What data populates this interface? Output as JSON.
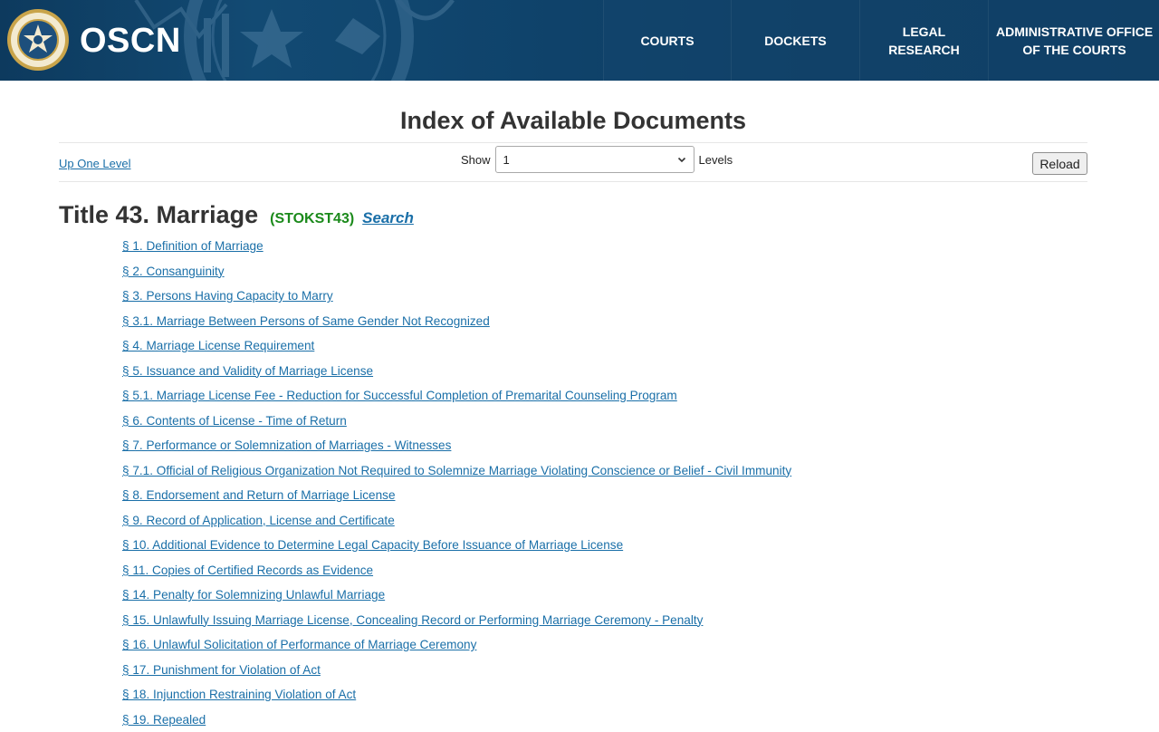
{
  "header": {
    "brand": "OSCN",
    "nav": [
      {
        "label": "COURTS"
      },
      {
        "label": "DOCKETS"
      },
      {
        "label": "LEGAL\nRESEARCH"
      },
      {
        "label": "ADMINISTRATIVE OFFICE\nOF THE COURTS"
      }
    ]
  },
  "page": {
    "title": "Index of Available Documents"
  },
  "controls": {
    "up_link": "Up One Level",
    "show_label": "Show",
    "levels_value": "1",
    "levels_label": "Levels",
    "reload_label": "Reload"
  },
  "title_block": {
    "title": "Title 43. Marriage",
    "code": "(STOKST43)",
    "search_label": "Search"
  },
  "sections": [
    "§ 1. Definition of Marriage",
    "§ 2. Consanguinity",
    "§ 3. Persons Having Capacity to Marry",
    "§ 3.1. Marriage Between Persons of Same Gender Not Recognized",
    "§ 4. Marriage License Requirement",
    "§ 5. Issuance and Validity of Marriage License",
    "§ 5.1. Marriage License Fee - Reduction for Successful Completion of Premarital Counseling Program",
    "§ 6. Contents of License - Time of Return",
    "§ 7. Performance or Solemnization of Marriages - Witnesses",
    "§ 7.1. Official of Religious Organization Not Required to Solemnize Marriage Violating Conscience or Belief - Civil Immunity",
    "§ 8. Endorsement and Return of Marriage License",
    "§ 9. Record of Application, License and Certificate",
    "§ 10. Additional Evidence to Determine Legal Capacity Before Issuance of Marriage License",
    "§ 11. Copies of Certified Records as Evidence",
    "§ 14. Penalty for Solemnizing Unlawful Marriage",
    "§ 15. Unlawfully Issuing Marriage License, Concealing Record or Performing Marriage Ceremony - Penalty",
    "§ 16. Unlawful Solicitation of Performance of Marriage Ceremony",
    "§ 17. Punishment for Violation of Act",
    "§ 18. Injunction Restraining Violation of Act",
    "§ 19. Repealed"
  ],
  "colors": {
    "header_bg": "#0f436b",
    "link": "#1a6fa8",
    "code_green": "#1b8a1b",
    "seal_gold": "#c9a44a"
  },
  "icons": {
    "seal": "supreme-court-seal-icon",
    "select_arrow": "chevron-down-icon"
  }
}
